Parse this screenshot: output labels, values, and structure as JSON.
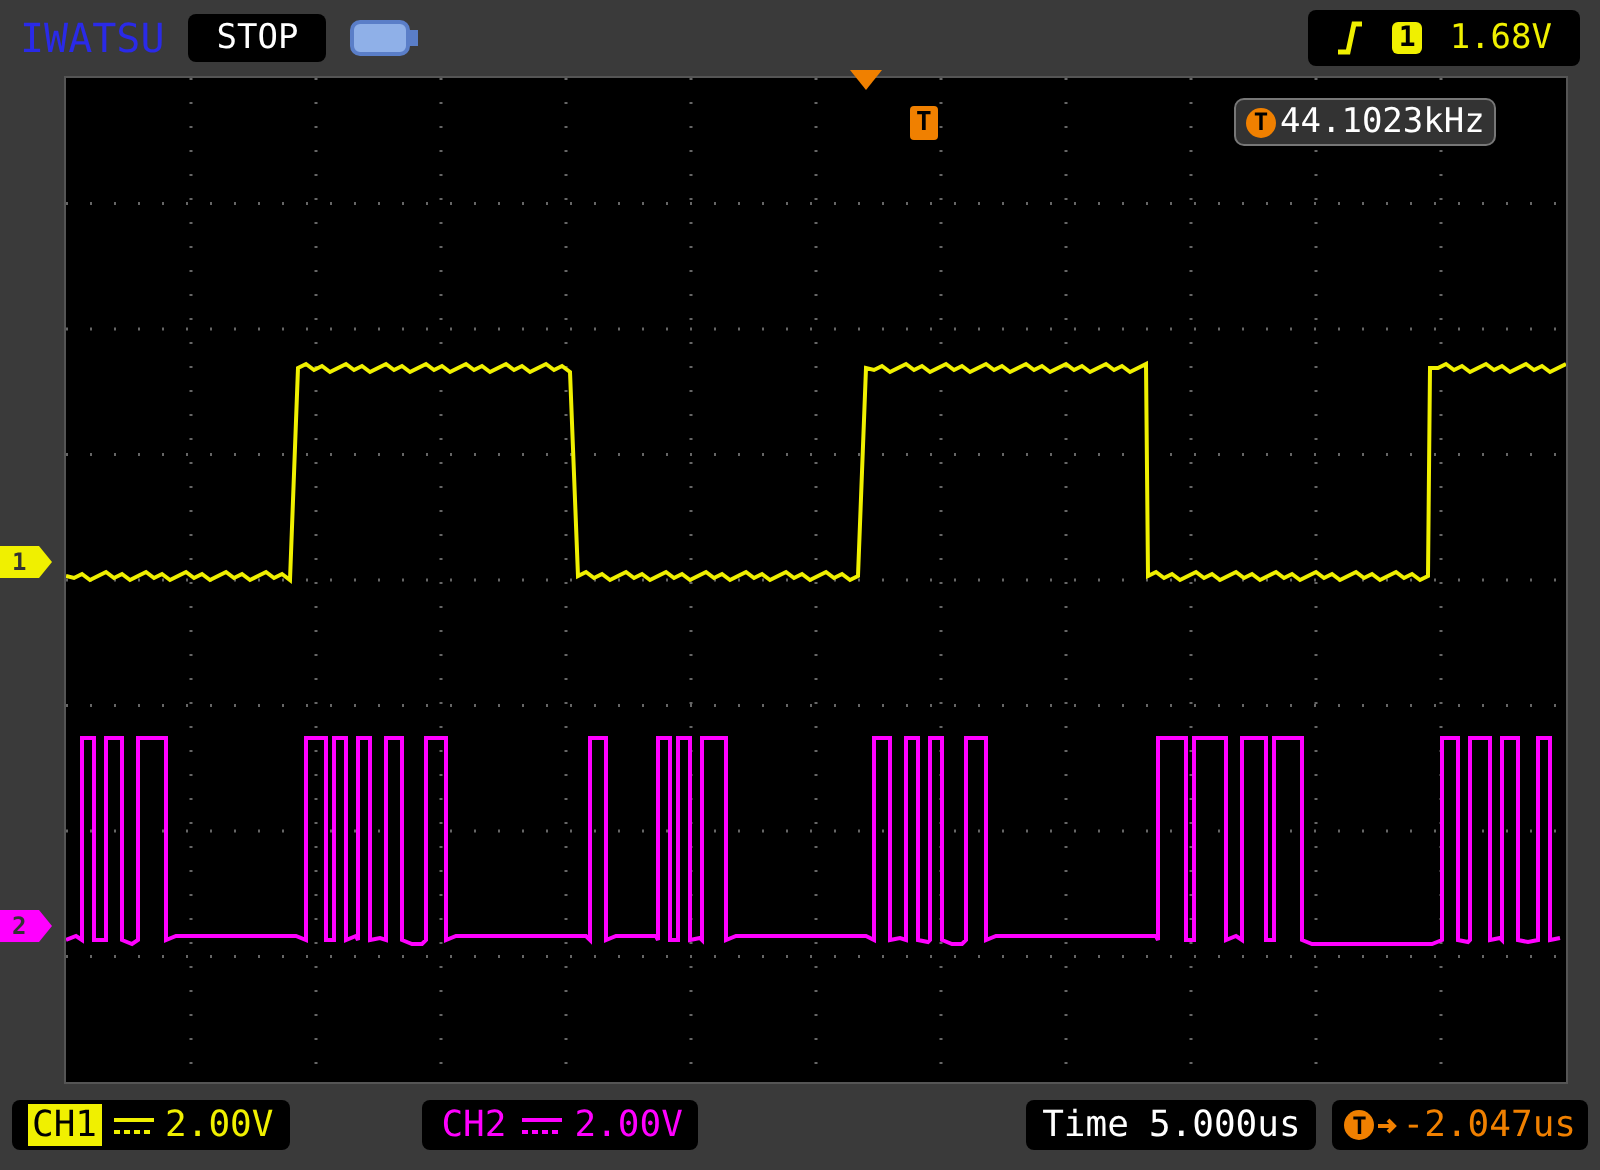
{
  "top_bar": {
    "brand": "IWATSU",
    "run_state": "STOP",
    "trigger": {
      "channel": "1",
      "level": "1.68V"
    }
  },
  "screen": {
    "trigger_marker": "T",
    "frequency": {
      "marker": "T",
      "value": "44.1023kHz"
    },
    "channel_markers": [
      {
        "label": "1",
        "color": "#f0f000"
      },
      {
        "label": "2",
        "color": "#ff00ff"
      }
    ]
  },
  "bottom_bar": {
    "channels": [
      {
        "label": "CH1",
        "scale": "2.00V",
        "selected": true,
        "color": "#f0f000"
      },
      {
        "label": "CH2",
        "scale": "2.00V",
        "selected": false,
        "color": "#ff00ff"
      }
    ],
    "time": {
      "label": "Time",
      "value": "5.000us"
    },
    "trigger_offset": {
      "marker": "T",
      "value": "-2.047us"
    }
  }
}
